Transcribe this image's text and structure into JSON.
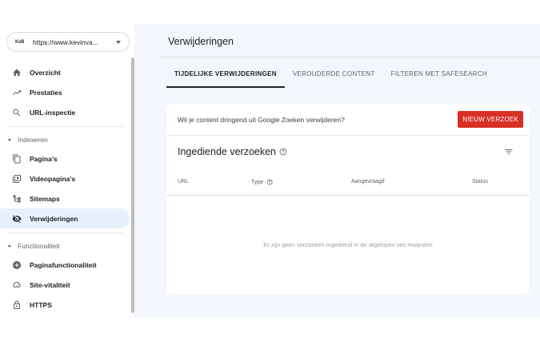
{
  "property": {
    "logo_text": "KvB",
    "url": "https://www.kevinva..."
  },
  "nav": {
    "items_top": [
      {
        "label": "Overzicht",
        "icon": "home-icon"
      },
      {
        "label": "Prestaties",
        "icon": "trending-up-icon"
      },
      {
        "label": "URL-inspectie",
        "icon": "search-icon"
      }
    ],
    "section_indexeren": "Indexeren",
    "items_indexeren": [
      {
        "label": "Pagina's",
        "icon": "pages-icon"
      },
      {
        "label": "Videopagina's",
        "icon": "video-pages-icon"
      },
      {
        "label": "Sitemaps",
        "icon": "sitemap-icon"
      },
      {
        "label": "Verwijderingen",
        "icon": "eye-off-icon",
        "active": true
      }
    ],
    "section_functionaliteit": "Functionaliteit",
    "items_functionaliteit": [
      {
        "label": "Paginafunctionaliteit",
        "icon": "add-circle-icon"
      },
      {
        "label": "Site-vitaliteit",
        "icon": "gauge-icon"
      },
      {
        "label": "HTTPS",
        "icon": "lock-icon"
      }
    ]
  },
  "main": {
    "title": "Verwijderingen",
    "tabs": [
      {
        "label": "TIJDELIJKE VERWIJDERINGEN",
        "active": true
      },
      {
        "label": "VEROUDERDE CONTENT"
      },
      {
        "label": "FILTEREN MET SAFESEARCH"
      }
    ],
    "banner_text": "Wil je content dringend uit Google Zoeken verwijderen?",
    "new_request_label": "NIEUW VERZOEK",
    "card_title": "Ingediende verzoeken",
    "columns": [
      "URL",
      "Type",
      "Aangevraagd",
      "Status"
    ],
    "empty_message": "Er zijn geen verzoeken ingediend in de afgelopen zes maanden"
  },
  "colors": {
    "accent_red": "#d93025",
    "active_nav_bg": "#e8f0fe",
    "main_bg": "#f3f6fc"
  }
}
